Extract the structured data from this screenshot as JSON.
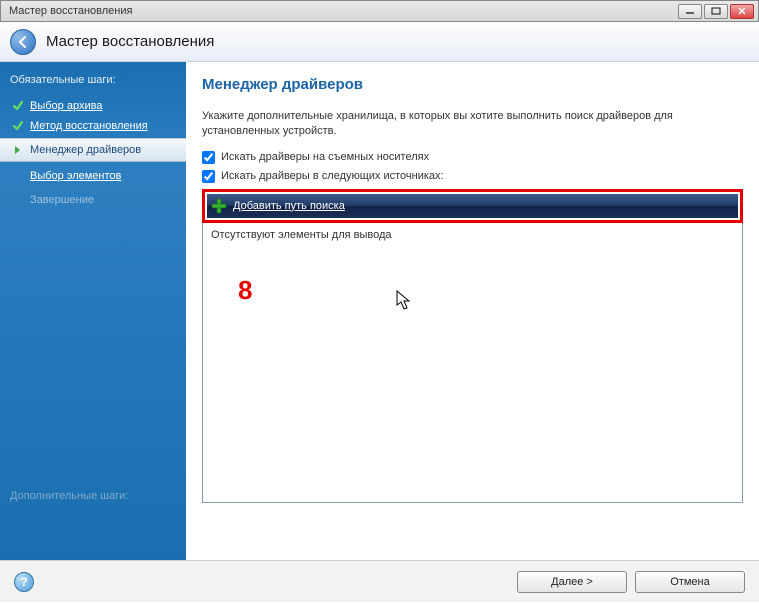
{
  "window": {
    "title": "Мастер восстановления"
  },
  "header": {
    "title": "Мастер восстановления"
  },
  "sidebar": {
    "section1": "Обязательные шаги:",
    "items": [
      {
        "label": "Выбор архива"
      },
      {
        "label": "Метод восстановления"
      },
      {
        "label": "Менеджер драйверов"
      },
      {
        "label": "Выбор элементов"
      },
      {
        "label": "Завершение"
      }
    ],
    "section2": "Дополнительные шаги:"
  },
  "main": {
    "title": "Менеджер драйверов",
    "instruction": "Укажите дополнительные хранилища, в которых вы хотите выполнить поиск драйверов для установленных устройств.",
    "chk1": "Искать драйверы на съемных носителях",
    "chk2": "Искать драйверы в следующих источниках:",
    "addPath": "Добавить путь поиска",
    "empty": "Отсутствуют элементы для вывода"
  },
  "footer": {
    "next": "Далее >",
    "cancel": "Отмена"
  },
  "annotation": "8"
}
